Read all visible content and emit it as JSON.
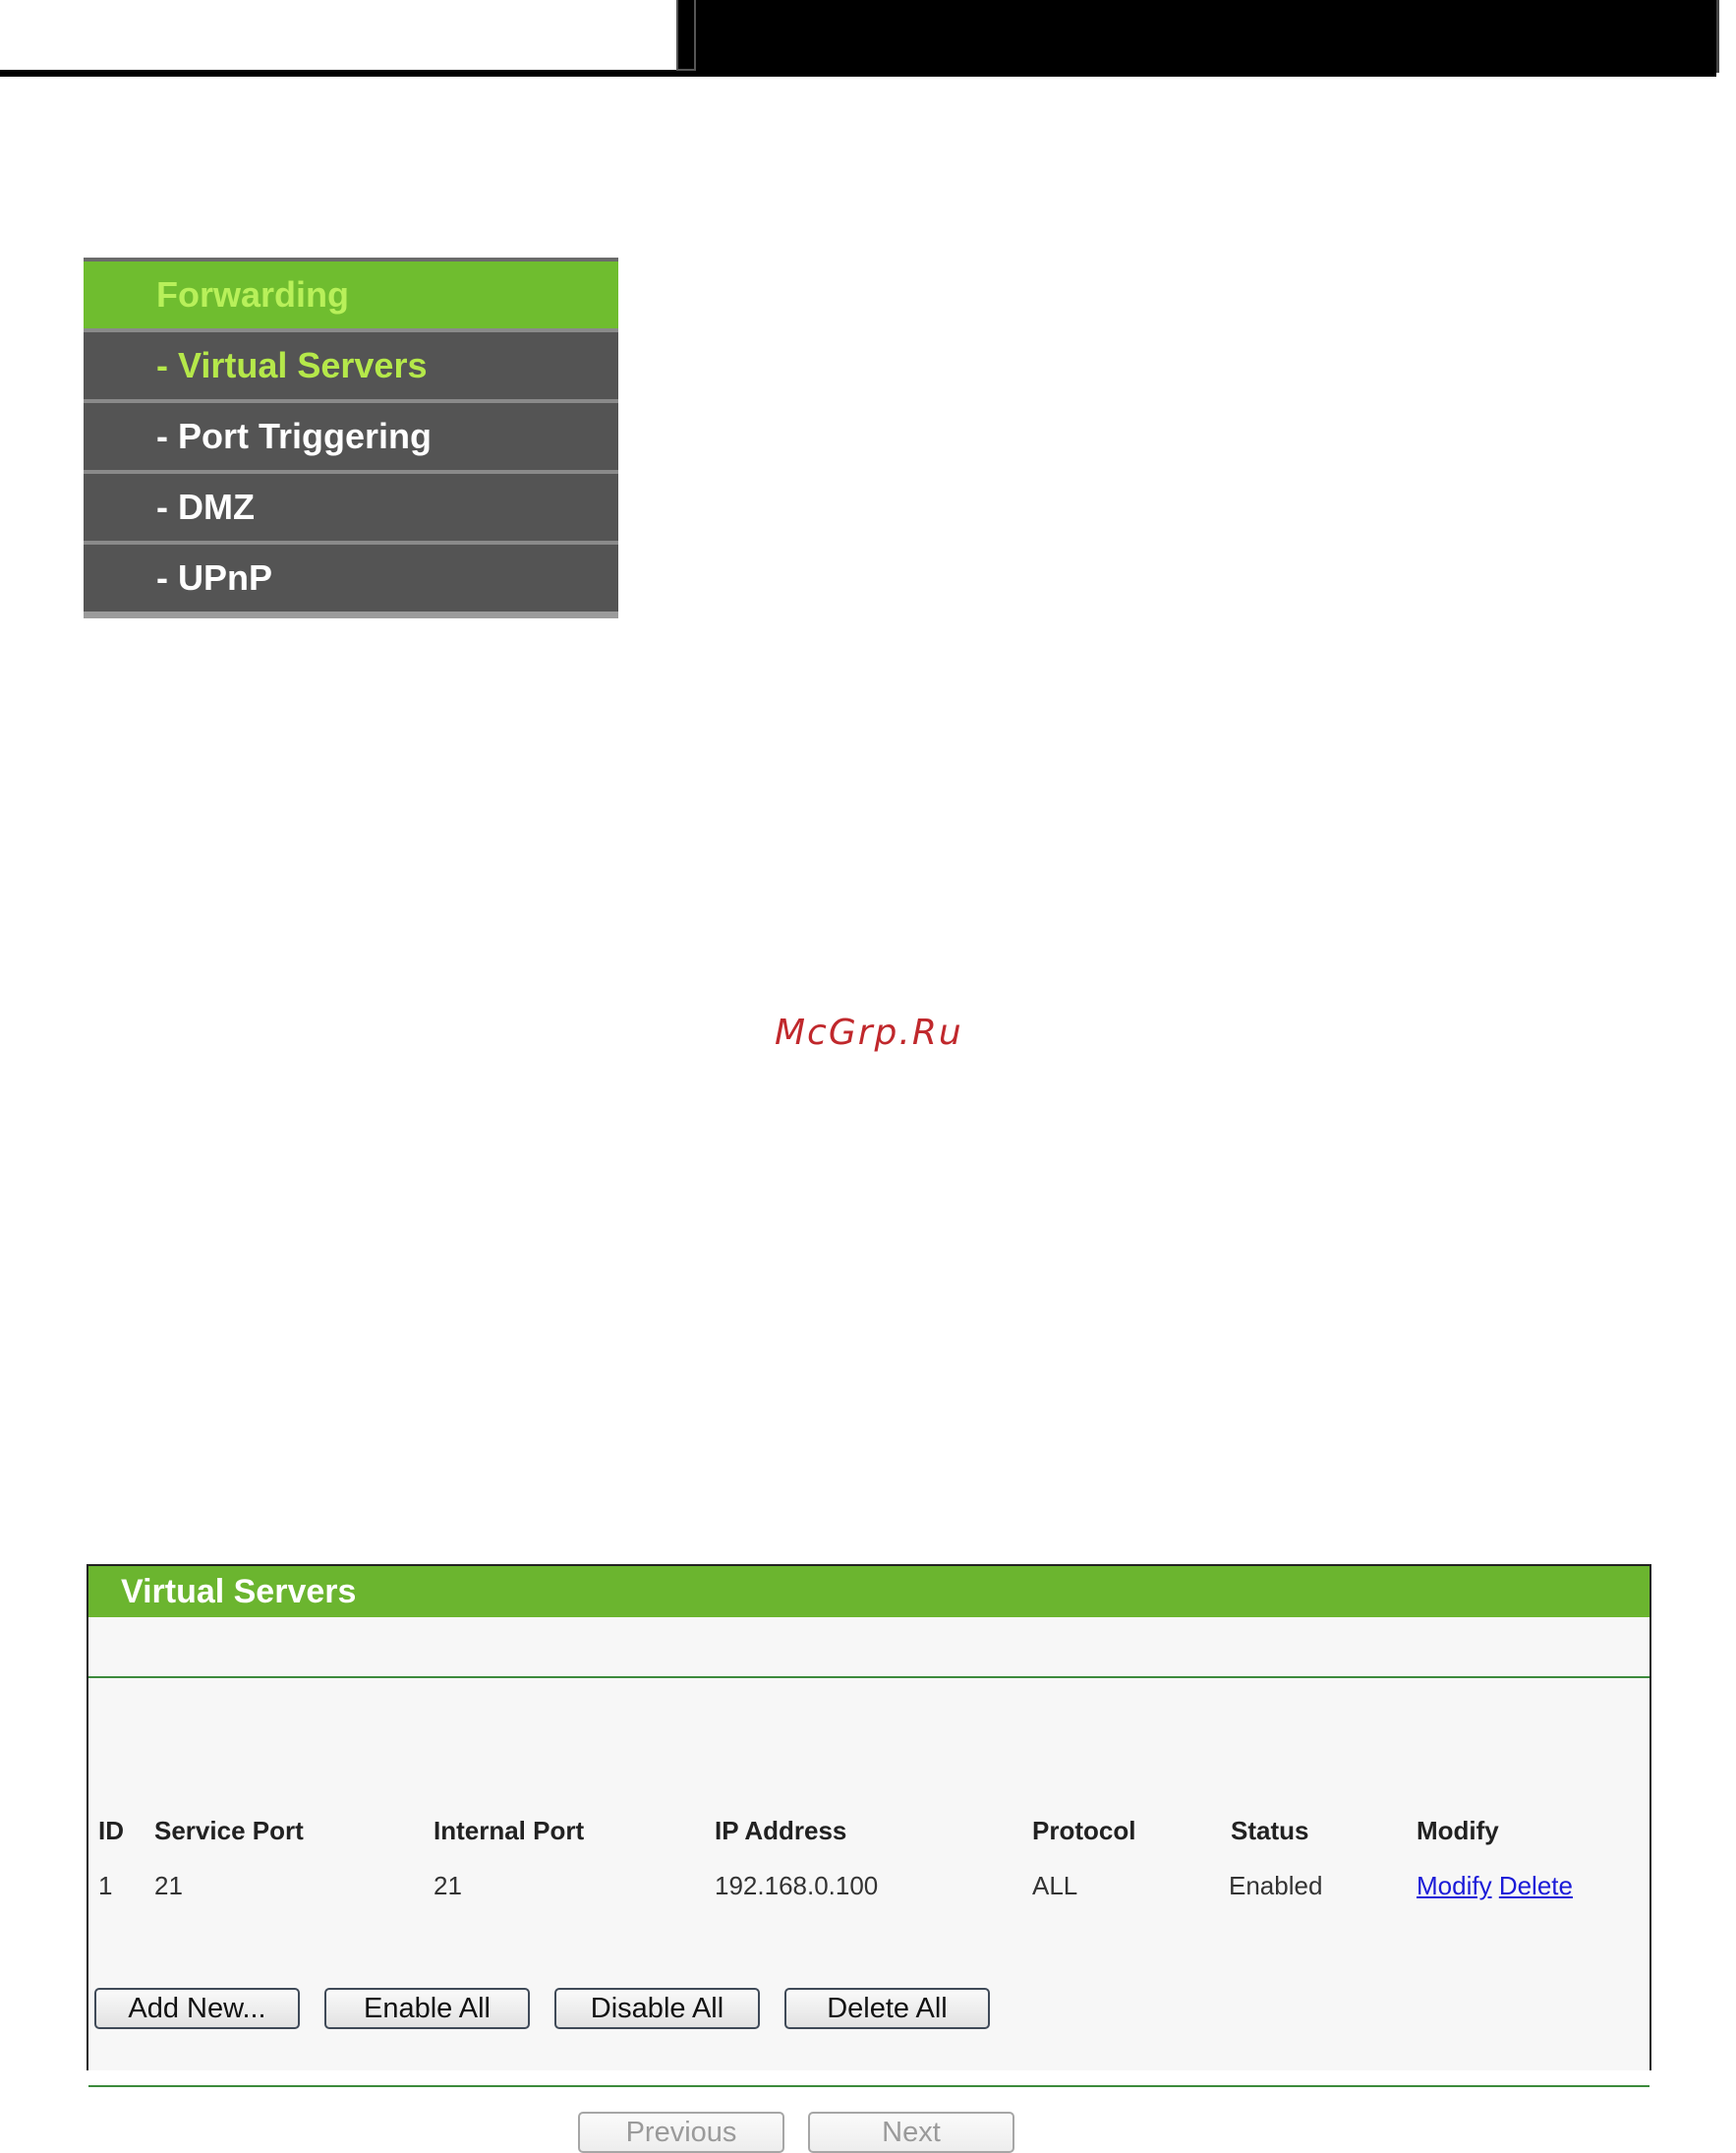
{
  "menu": {
    "items": [
      {
        "label": "Forwarding"
      },
      {
        "label": "- Virtual Servers"
      },
      {
        "label": "- Port Triggering"
      },
      {
        "label": "- DMZ"
      },
      {
        "label": "- UPnP"
      }
    ]
  },
  "watermark": "McGrp.Ru",
  "panel": {
    "title": "Virtual Servers",
    "columns": [
      "ID",
      "Service Port",
      "Internal Port",
      "IP Address",
      "Protocol",
      "Status",
      "Modify"
    ],
    "rows": [
      {
        "id": "1",
        "service_port": "21",
        "internal_port": "21",
        "ip_address": "192.168.0.100",
        "protocol": "ALL",
        "status": "Enabled",
        "modify_link": "Modify",
        "delete_link": "Delete"
      }
    ],
    "buttons": {
      "add_new": "Add New...",
      "enable_all": "Enable All",
      "disable_all": "Disable All",
      "delete_all": "Delete All",
      "previous": "Previous",
      "next": "Next"
    }
  },
  "colors": {
    "menu_header": "#6fbd2f",
    "menu_item_bg": "#545454",
    "menu_active_text": "#b5e84a",
    "panel_title_bg": "#6bb52f",
    "link": "#1b1bd8"
  }
}
